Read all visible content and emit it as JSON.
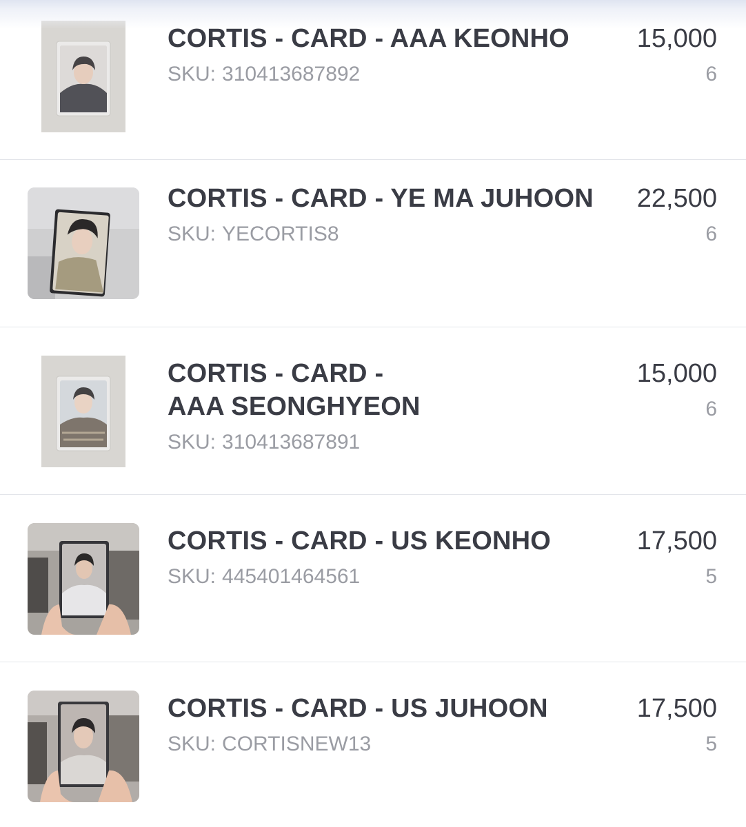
{
  "sku_prefix": "SKU:",
  "products": [
    {
      "title_lines": [
        "CORTIS - CARD - AAA KEONHO"
      ],
      "sku": "310413687892",
      "price": "15,000",
      "quantity": "6",
      "thumbnail": "photocard-in-sleeve"
    },
    {
      "title_lines": [
        "CORTIS - CARD - YE MA JUHOON"
      ],
      "sku": "YECORTIS8",
      "price": "22,500",
      "quantity": "6",
      "thumbnail": "photocard-photo"
    },
    {
      "title_lines": [
        "CORTIS - CARD -",
        "AAA SEONGHYEON"
      ],
      "sku": "310413687891",
      "price": "15,000",
      "quantity": "6",
      "thumbnail": "photocard-in-sleeve"
    },
    {
      "title_lines": [
        "CORTIS - CARD - US KEONHO"
      ],
      "sku": "445401464561",
      "price": "17,500",
      "quantity": "5",
      "thumbnail": "photocard-held-in-hand"
    },
    {
      "title_lines": [
        "CORTIS - CARD - US JUHOON"
      ],
      "sku": "CORTISNEW13",
      "price": "17,500",
      "quantity": "5",
      "thumbnail": "photocard-held-in-hand"
    }
  ]
}
